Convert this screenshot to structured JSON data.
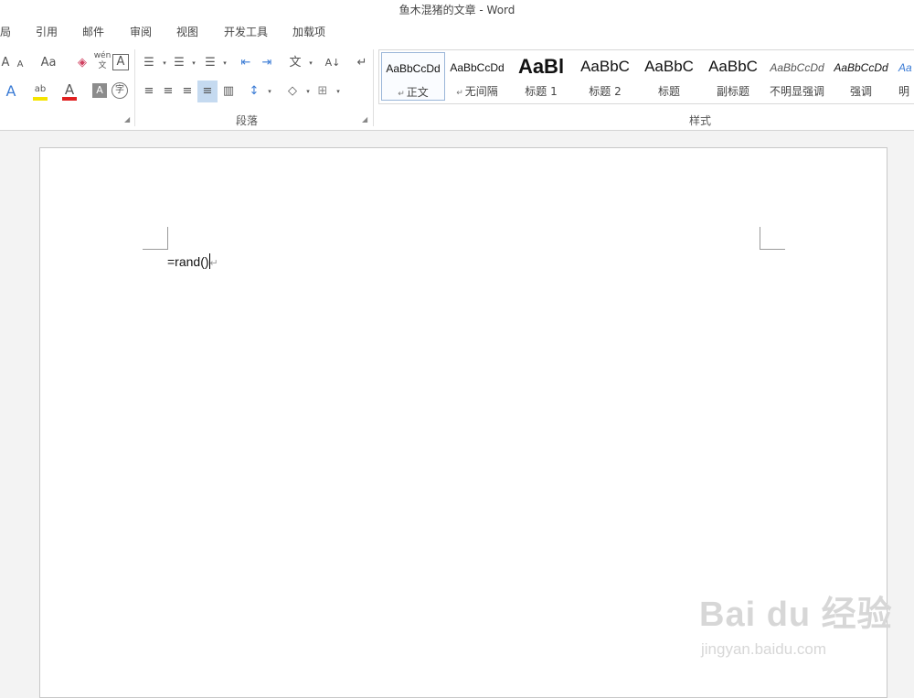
{
  "window": {
    "title": "鱼木混猪的文章 - Word"
  },
  "tabs": [
    {
      "label": "局"
    },
    {
      "label": "引用"
    },
    {
      "label": "邮件"
    },
    {
      "label": "审阅"
    },
    {
      "label": "视图"
    },
    {
      "label": "开发工具"
    },
    {
      "label": "加载项"
    }
  ],
  "ribbon": {
    "font_row1": [
      {
        "icon": "grow-font-icon",
        "glyph": "A"
      },
      {
        "icon": "shrink-font-icon",
        "glyph": "A"
      },
      {
        "icon": "change-case-icon",
        "glyph": "Aa"
      },
      {
        "icon": "clear-formatting-icon",
        "glyph": "◈"
      },
      {
        "icon": "phonetic-guide-icon",
        "glyph": "wén",
        "sub": "文"
      },
      {
        "icon": "character-border-icon",
        "glyph": "A"
      }
    ],
    "font_row2": [
      {
        "icon": "text-effects-icon",
        "glyph": "A"
      },
      {
        "icon": "highlight-color-icon",
        "glyph": "ab"
      },
      {
        "icon": "font-color-icon",
        "glyph": "A"
      },
      {
        "icon": "character-shading-icon",
        "glyph": "A"
      },
      {
        "icon": "enclose-characters-icon",
        "glyph": "字"
      }
    ],
    "paragraph_row1": [
      {
        "icon": "bullets-icon",
        "glyph": "☰"
      },
      {
        "icon": "numbering-icon",
        "glyph": "☰"
      },
      {
        "icon": "multilevel-list-icon",
        "glyph": "☰"
      },
      {
        "icon": "decrease-indent-icon",
        "glyph": "⇤"
      },
      {
        "icon": "increase-indent-icon",
        "glyph": "⇥"
      },
      {
        "icon": "chinese-layout-icon",
        "glyph": "文"
      },
      {
        "icon": "sort-icon",
        "glyph": "A↓"
      },
      {
        "icon": "show-hide-marks-icon",
        "glyph": "↵"
      }
    ],
    "paragraph_row2": [
      {
        "icon": "align-left-icon",
        "glyph": "≡"
      },
      {
        "icon": "align-center-icon",
        "glyph": "≡"
      },
      {
        "icon": "align-right-icon",
        "glyph": "≡"
      },
      {
        "icon": "justify-icon",
        "glyph": "≡"
      },
      {
        "icon": "distributed-icon",
        "glyph": "▥"
      },
      {
        "icon": "line-spacing-icon",
        "glyph": "↕"
      },
      {
        "icon": "shading-icon",
        "glyph": "◇"
      },
      {
        "icon": "borders-icon",
        "glyph": "⊞"
      }
    ],
    "groups": {
      "font_partial": "",
      "paragraph": "段落",
      "styles": "样式"
    }
  },
  "styles": [
    {
      "preview": "AaBbCcDd",
      "name": "正文",
      "has_mark": true,
      "selected": true
    },
    {
      "preview": "AaBbCcDd",
      "name": "无间隔",
      "has_mark": true,
      "selected": false
    },
    {
      "preview": "AaBl",
      "name": "标题 1",
      "has_mark": false,
      "selected": false
    },
    {
      "preview": "AaBbC",
      "name": "标题 2",
      "has_mark": false,
      "selected": false
    },
    {
      "preview": "AaBbC",
      "name": "标题",
      "has_mark": false,
      "selected": false
    },
    {
      "preview": "AaBbC",
      "name": "副标题",
      "has_mark": false,
      "selected": false
    },
    {
      "preview": "AaBbCcDd",
      "name": "不明显强调",
      "has_mark": false,
      "selected": false
    },
    {
      "preview": "AaBbCcDd",
      "name": "强调",
      "has_mark": false,
      "selected": false
    },
    {
      "preview": "Aa",
      "name": "明",
      "has_mark": false,
      "selected": false
    }
  ],
  "document": {
    "text": "=rand()",
    "paragraph_mark": "↵"
  },
  "watermark": {
    "main": "Bai du 经验",
    "sub": "jingyan.baidu.com"
  },
  "colors": {
    "font_color_bar": "#e02020",
    "highlight_bar": "#f5e400",
    "accent_border": "#9ab5d8"
  }
}
